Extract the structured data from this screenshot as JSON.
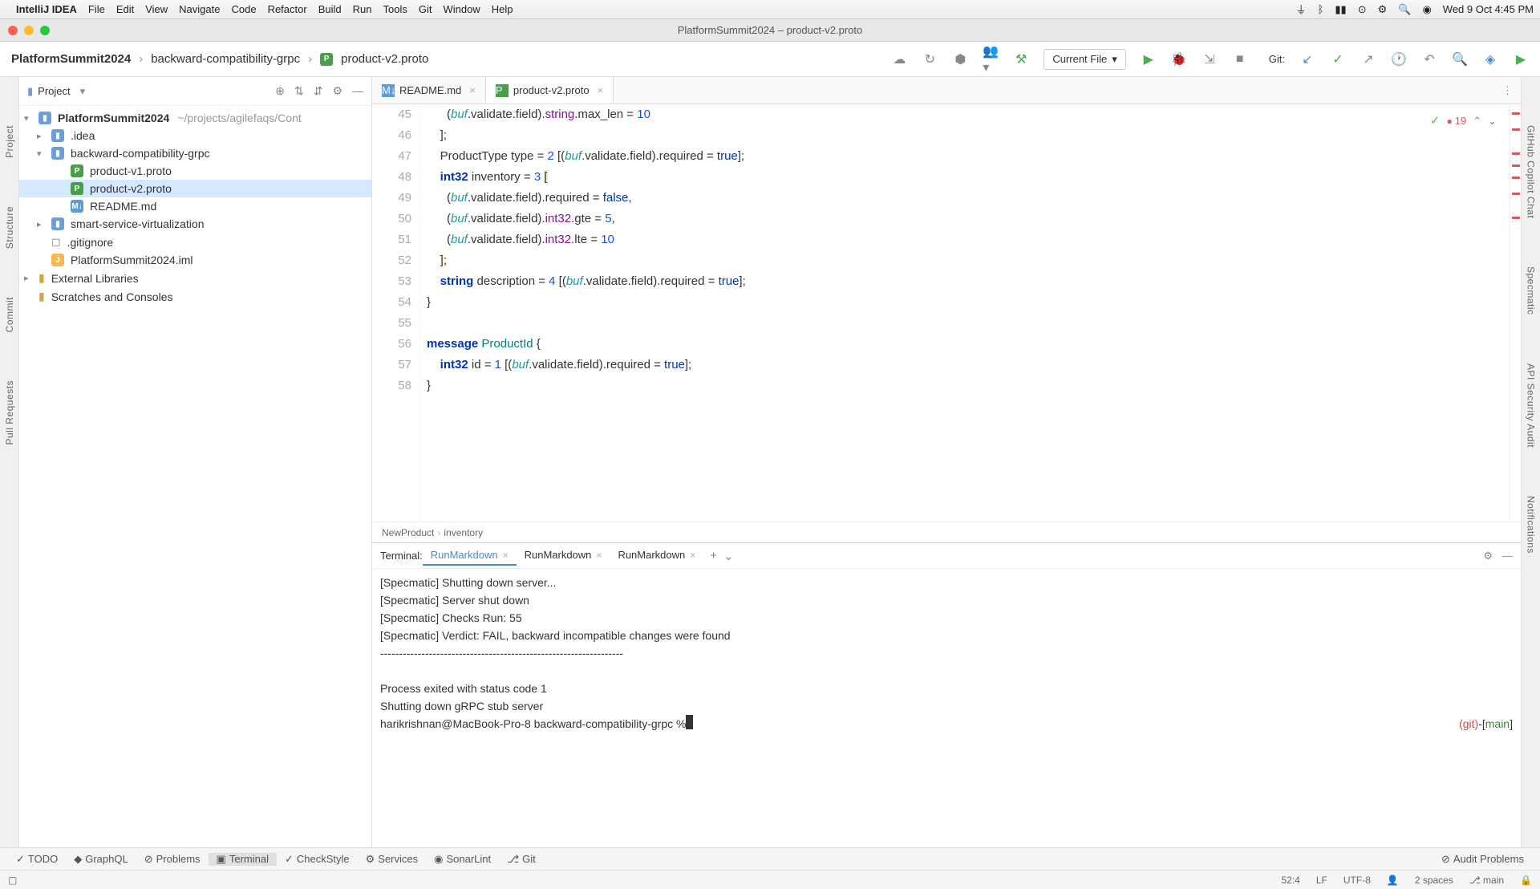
{
  "menubar": {
    "app": "IntelliJ IDEA",
    "items": [
      "File",
      "Edit",
      "View",
      "Navigate",
      "Code",
      "Refactor",
      "Build",
      "Run",
      "Tools",
      "Git",
      "Window",
      "Help"
    ],
    "date": "Wed 9 Oct  4:45 PM"
  },
  "window": {
    "title": "PlatformSummit2024 – product-v2.proto"
  },
  "navbar": {
    "crumbs": [
      "PlatformSummit2024",
      "backward-compatibility-grpc",
      "product-v2.proto"
    ],
    "currentfile": "Current File",
    "git": "Git:"
  },
  "project": {
    "title": "Project",
    "root": "PlatformSummit2024",
    "rootpath": "~/projects/agilefaqs/Cont",
    "nodes": [
      {
        "label": ".idea",
        "type": "folder",
        "indent": 1,
        "chev": "▸"
      },
      {
        "label": "backward-compatibility-grpc",
        "type": "folder",
        "indent": 1,
        "chev": "▾"
      },
      {
        "label": "product-v1.proto",
        "type": "proto",
        "indent": 2
      },
      {
        "label": "product-v2.proto",
        "type": "proto",
        "indent": 2,
        "sel": true
      },
      {
        "label": "README.md",
        "type": "md",
        "indent": 2
      },
      {
        "label": "smart-service-virtualization",
        "type": "folder",
        "indent": 1,
        "chev": "▸"
      },
      {
        "label": ".gitignore",
        "type": "file",
        "indent": 1
      },
      {
        "label": "PlatformSummit2024.iml",
        "type": "iml",
        "indent": 1
      }
    ],
    "extlibs": "External Libraries",
    "scratches": "Scratches and Consoles"
  },
  "tabs": [
    {
      "label": "README.md",
      "icon": "md"
    },
    {
      "label": "product-v2.proto",
      "icon": "proto",
      "active": true
    }
  ],
  "code": {
    "start": 45,
    "errors": "19",
    "lines": [
      "      (buf.validate.field).string.max_len = 10",
      "    ];",
      "    ProductType type = 2 [(buf.validate.field).required = true];",
      "    int32 inventory = 3 [",
      "      (buf.validate.field).required = false,",
      "      (buf.validate.field).int32.gte = 5,",
      "      (buf.validate.field).int32.lte = 10",
      "    ];",
      "    string description = 4 [(buf.validate.field).required = true];",
      "}",
      "",
      "message ProductId {",
      "    int32 id = 1 [(buf.validate.field).required = true];",
      "}"
    ],
    "breadcrumb": [
      "NewProduct",
      "inventory"
    ]
  },
  "terminal": {
    "title": "Terminal:",
    "tabs": [
      "RunMarkdown",
      "RunMarkdown",
      "RunMarkdown"
    ],
    "lines": [
      "[Specmatic] Shutting down server...",
      "[Specmatic] Server shut down",
      "",
      "",
      "",
      "[Specmatic] Checks Run: 55",
      "[Specmatic] Verdict: FAIL, backward incompatible changes were found",
      "-----------------------------------------------------------------",
      "",
      "Process exited with status code 1",
      "Shutting down gRPC stub server"
    ],
    "prompt": "harikrishnan@MacBook-Pro-8 backward-compatibility-grpc % ",
    "git": "(git)-[main]"
  },
  "bottombar": {
    "items": [
      "TODO",
      "GraphQL",
      "Problems",
      "Terminal",
      "CheckStyle",
      "Services",
      "SonarLint",
      "Git"
    ],
    "audit": "Audit Problems"
  },
  "status": {
    "pos": "52:4",
    "eol": "LF",
    "enc": "UTF-8",
    "indent": "2 spaces",
    "branch": "main"
  }
}
